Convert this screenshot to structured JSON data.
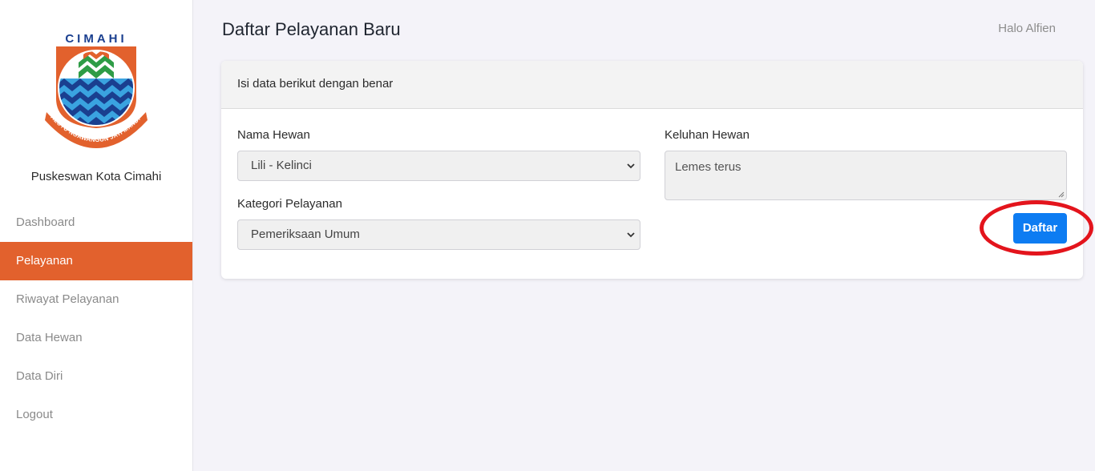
{
  "sidebar": {
    "logo_text": "CIMAHI",
    "logo_motto": "SALUYU NGAWANGUN JATI MANDIRI",
    "org_name": "Puskeswan Kota Cimahi",
    "items": [
      {
        "label": "Dashboard",
        "active": false
      },
      {
        "label": "Pelayanan",
        "active": true
      },
      {
        "label": "Riwayat Pelayanan",
        "active": false
      },
      {
        "label": "Data Hewan",
        "active": false
      },
      {
        "label": "Data Diri",
        "active": false
      },
      {
        "label": "Logout",
        "active": false
      }
    ]
  },
  "header": {
    "title": "Daftar Pelayanan Baru",
    "greeting": "Halo Alfien"
  },
  "form": {
    "card_header": "Isi data berikut dengan benar",
    "nama_hewan_label": "Nama Hewan",
    "nama_hewan_value": "Lili - Kelinci",
    "kategori_label": "Kategori Pelayanan",
    "kategori_value": "Pemeriksaan Umum",
    "keluhan_label": "Keluhan Hewan",
    "keluhan_value": "Lemes terus",
    "submit_label": "Daftar"
  },
  "colors": {
    "accent_active": "#e2612d",
    "primary_button": "#0d7cf2",
    "highlight_ring": "#e3141c"
  }
}
